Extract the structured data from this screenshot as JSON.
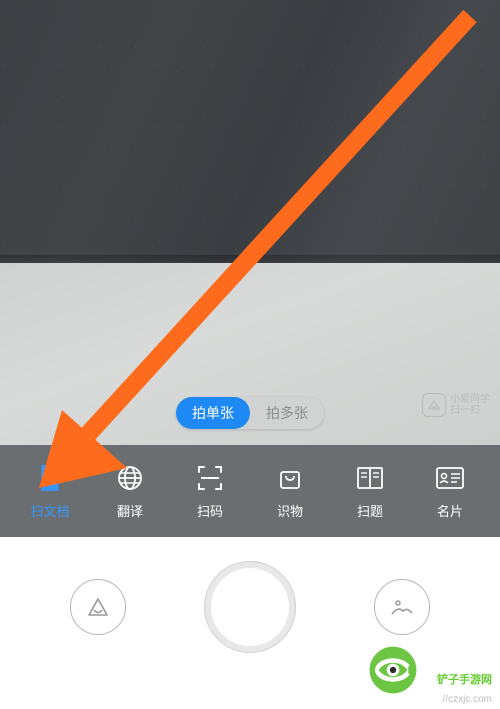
{
  "shot_modes": {
    "single": "拍单张",
    "multi": "拍多张"
  },
  "xiaoai": {
    "line1": "小爱同学",
    "line2": "扫一扫"
  },
  "scan_modes": {
    "document": "扫文档",
    "translate": "翻译",
    "qrcode": "扫码",
    "identify": "识物",
    "homework": "扫题",
    "businesscard": "名片"
  },
  "watermark": {
    "line1": "铲子手游网",
    "url": "//czxjc.com"
  }
}
